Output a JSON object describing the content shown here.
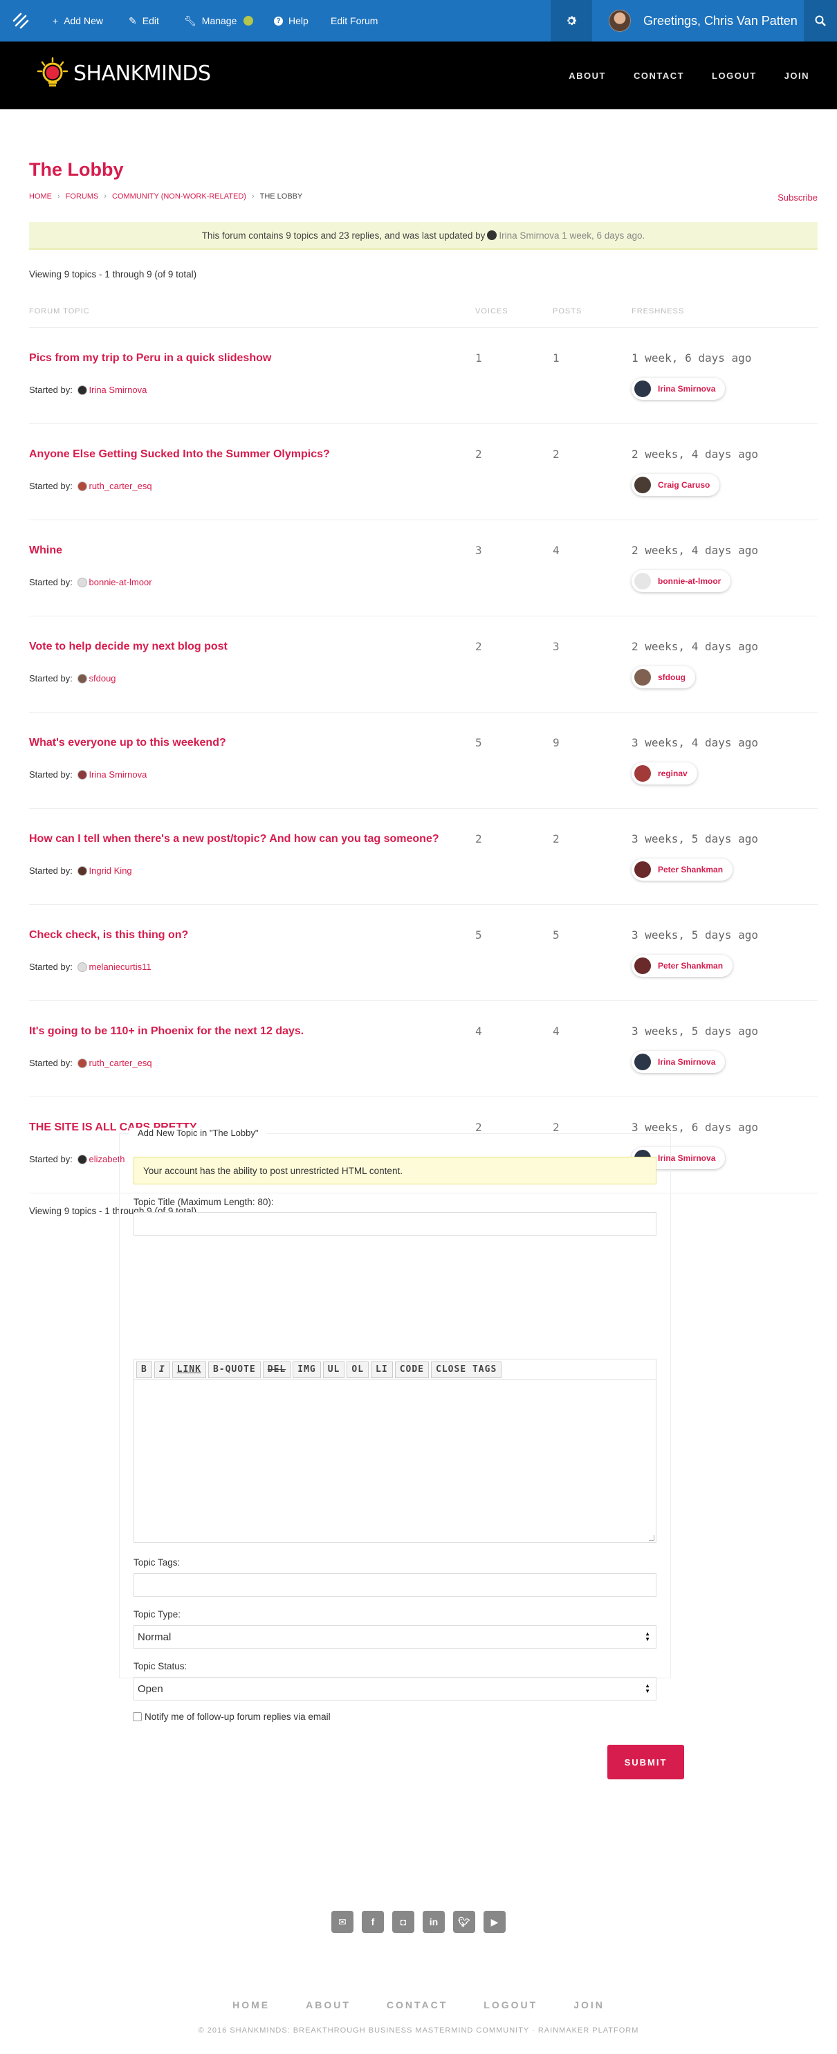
{
  "adminbar": {
    "items": [
      {
        "icon": "plus-icon",
        "label": "Add New"
      },
      {
        "icon": "pencil-icon",
        "label": "Edit"
      },
      {
        "icon": "wrench-icon",
        "label": "Manage"
      },
      {
        "icon": "help-icon",
        "label": "Help"
      },
      {
        "icon": "",
        "label": "Edit Forum"
      }
    ],
    "greeting": "Greetings, Chris Van Patten"
  },
  "header": {
    "brand": "SHANKMINDS",
    "nav": [
      "ABOUT",
      "CONTACT",
      "LOGOUT",
      "JOIN"
    ]
  },
  "page": {
    "title": "The Lobby",
    "breadcrumbs": [
      "HOME",
      "FORUMS",
      "COMMUNITY (NON-WORK-RELATED)",
      "THE LOBBY"
    ],
    "subscribe": "Subscribe",
    "notice_prefix": "This forum contains 9 topics and 23 replies, and was last updated by",
    "notice_user": "Irina Smirnova",
    "notice_time": "1 week, 6 days ago.",
    "viewing": "Viewing 9 topics - 1 through 9 (of 9 total)",
    "columns": [
      "FORUM TOPIC",
      "VOICES",
      "POSTS",
      "FRESHNESS"
    ],
    "started_by_label": "Started by:"
  },
  "topics": [
    {
      "title": "Pics from my trip to Peru in a quick slideshow",
      "author": "Irina Smirnova",
      "voices": "1",
      "posts": "1",
      "freshness": "1 week, 6 days ago",
      "last_by": "Irina Smirnova"
    },
    {
      "title": "Anyone Else Getting Sucked Into the Summer Olympics?",
      "author": "ruth_carter_esq",
      "voices": "2",
      "posts": "2",
      "freshness": "2 weeks, 4 days ago",
      "last_by": "Craig Caruso"
    },
    {
      "title": "Whine",
      "author": "bonnie-at-lmoor",
      "voices": "3",
      "posts": "4",
      "freshness": "2 weeks, 4 days ago",
      "last_by": "bonnie-at-lmoor"
    },
    {
      "title": "Vote to help decide my next blog post",
      "author": "sfdoug",
      "voices": "2",
      "posts": "3",
      "freshness": "2 weeks, 4 days ago",
      "last_by": "sfdoug"
    },
    {
      "title": "What's everyone up to this weekend?",
      "author": "Irina Smirnova",
      "voices": "5",
      "posts": "9",
      "freshness": "3 weeks, 4 days ago",
      "last_by": "reginav"
    },
    {
      "title": "How can I tell when there's a new post/topic? And how can you tag someone?",
      "author": "Ingrid King",
      "voices": "2",
      "posts": "2",
      "freshness": "3 weeks, 5 days ago",
      "last_by": "Peter Shankman"
    },
    {
      "title": "Check check, is this thing on?",
      "author": "melaniecurtis11",
      "voices": "5",
      "posts": "5",
      "freshness": "3 weeks, 5 days ago",
      "last_by": "Peter Shankman"
    },
    {
      "title": "It's going to be 110+ in Phoenix for the next 12 days.",
      "author": "ruth_carter_esq",
      "voices": "4",
      "posts": "4",
      "freshness": "3 weeks, 5 days ago",
      "last_by": "Irina Smirnova"
    },
    {
      "title": "THE SITE IS ALL CAPS PRETTY.",
      "author": "elizabeth",
      "voices": "2",
      "posts": "2",
      "freshness": "3 weeks, 6 days ago",
      "last_by": "Irina Smirnova"
    }
  ],
  "form": {
    "legend": "Add New Topic in \"The Lobby\"",
    "notice": "Your account has the ability to post unrestricted HTML content.",
    "title_label": "Topic Title (Maximum Length: 80):",
    "toolbar": [
      "B",
      "I",
      "LINK",
      "B-QUOTE",
      "DEL",
      "IMG",
      "UL",
      "OL",
      "LI",
      "CODE",
      "CLOSE TAGS"
    ],
    "tags_label": "Topic Tags:",
    "type_label": "Topic Type:",
    "type_value": "Normal",
    "status_label": "Topic Status:",
    "status_value": "Open",
    "notify_label": "Notify me of follow-up forum replies via email",
    "submit": "SUBMIT"
  },
  "footer": {
    "social": [
      "email-icon",
      "facebook-icon",
      "instagram-icon",
      "linkedin-icon",
      "twitter-icon",
      "youtube-icon"
    ],
    "nav": [
      "HOME",
      "ABOUT",
      "CONTACT",
      "LOGOUT",
      "JOIN"
    ],
    "copyright": "© 2016 SHANKMINDS: BREAKTHROUGH BUSINESS MASTERMIND COMMUNITY · RAINMAKER PLATFORM"
  },
  "colors": {
    "accent": "#d61d4d",
    "adminbar": "#1e73be",
    "header": "#000000",
    "notice_bg": "#f4f7d7"
  }
}
